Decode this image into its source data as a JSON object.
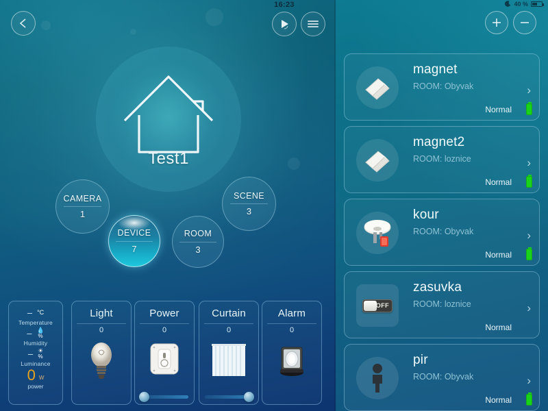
{
  "left": {
    "clock": "16:23",
    "back_icon": "chevron-left-icon",
    "play_icon": "play-refresh-icon",
    "menu_icon": "hamburger-menu-icon",
    "home": {
      "icon": "house-outline-icon",
      "name": "Test1"
    },
    "nav_circles": [
      {
        "label": "CAMERA",
        "count": "1",
        "active": false
      },
      {
        "label": "SCENE",
        "count": "3",
        "active": false
      },
      {
        "label": "DEVICE",
        "count": "7",
        "active": true
      },
      {
        "label": "ROOM",
        "count": "3",
        "active": false
      }
    ],
    "sensors": {
      "rows": [
        {
          "value": "–",
          "unit_glyph": "°C",
          "unit_sub": "",
          "name": "Temperature",
          "icon": "thermometer-icon"
        },
        {
          "value": "–",
          "unit_glyph": "💧",
          "unit_sub": "%",
          "name": "Humidity",
          "icon": "humidity-drop-icon"
        },
        {
          "value": "–",
          "unit_glyph": "☀",
          "unit_sub": "%",
          "name": "Luminance",
          "icon": "brightness-icon"
        }
      ],
      "power_value": "0",
      "power_unit": "W",
      "power_label": "power",
      "power_color": "#e8a31c"
    },
    "device_cards": [
      {
        "title": "Light",
        "count": "0",
        "icon": "lightbulb-icon",
        "slider": false,
        "slider_pct": 0
      },
      {
        "title": "Power",
        "count": "0",
        "icon": "wall-socket-icon",
        "slider": true,
        "slider_pct": 5
      },
      {
        "title": "Curtain",
        "count": "0",
        "icon": "curtain-icon",
        "slider": true,
        "slider_pct": 88
      },
      {
        "title": "Alarm",
        "count": "0",
        "icon": "siren-icon",
        "slider": false,
        "slider_pct": 0
      }
    ]
  },
  "right": {
    "status": {
      "moon_icon": "moon-icon",
      "battery_pct": "40 %",
      "battery_icon": "battery-icon"
    },
    "add_label": "+",
    "remove_label": "−",
    "chevron": "›",
    "devices": [
      {
        "name": "magnet",
        "room": "ROOM: Obyvak",
        "status": "Normal",
        "icon": "door-magnet-sensor-icon",
        "battery": true,
        "toggle": null
      },
      {
        "name": "magnet2",
        "room": "ROOM: loznice",
        "status": "Normal",
        "icon": "door-magnet-sensor-icon",
        "battery": true,
        "toggle": null
      },
      {
        "name": "kour",
        "room": "ROOM: Obyvak",
        "status": "Normal",
        "icon": "smoke-detector-icon",
        "battery": true,
        "toggle": null
      },
      {
        "name": "zasuvka",
        "room": "ROOM: loznice",
        "status": "Normal",
        "icon": "toggle-switch-icon",
        "battery": false,
        "toggle": "OFF"
      },
      {
        "name": "pir",
        "room": "ROOM: Obyvak",
        "status": "Normal",
        "icon": "motion-sensor-icon",
        "battery": true,
        "toggle": null
      }
    ]
  },
  "colors": {
    "accent": "#1fc7dd",
    "battery_green": "#19d21a",
    "power_orange": "#e8a31c"
  }
}
